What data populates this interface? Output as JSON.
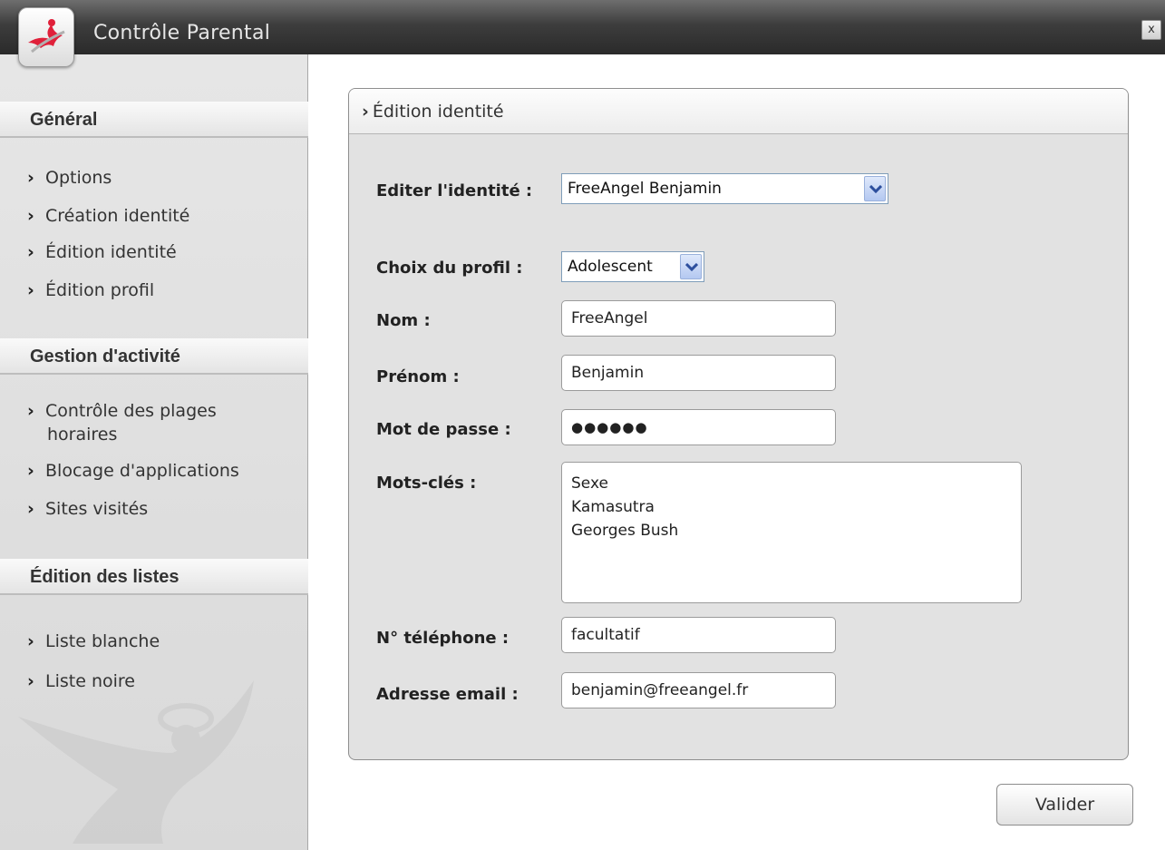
{
  "window": {
    "title": "Contrôle Parental",
    "close_label": "x"
  },
  "sidebar": {
    "sections": [
      {
        "title": "Général",
        "items": [
          "Options",
          "Création identité",
          "Édition identité",
          "Édition profil"
        ]
      },
      {
        "title": "Gestion d'activité",
        "items": [
          "Contrôle des plages",
          "horaires",
          "Blocage d'applications",
          "Sites visités"
        ]
      },
      {
        "title": "Édition des listes",
        "items": [
          "Liste blanche",
          "Liste noire"
        ]
      }
    ]
  },
  "panel": {
    "title": "Édition identité"
  },
  "form": {
    "identity": {
      "label": "Editer l'identité :",
      "value": "FreeAngel Benjamin"
    },
    "profile": {
      "label": "Choix du profil :",
      "value": "Adolescent"
    },
    "nom": {
      "label": "Nom :",
      "value": "FreeAngel"
    },
    "prenom": {
      "label": "Prénom :",
      "value": "Benjamin"
    },
    "password": {
      "label": "Mot de passe :",
      "value": "●●●●●●"
    },
    "keywords": {
      "label": "Mots-clés :",
      "lines": [
        "Sexe",
        "Kamasutra",
        "Georges Bush"
      ]
    },
    "phone": {
      "label": "N° téléphone :",
      "value": "facultatif"
    },
    "email": {
      "label": "Adresse email :",
      "value": "benjamin@freeangel.fr"
    }
  },
  "buttons": {
    "submit": "Valider"
  },
  "icons": {
    "logo": "angel-logo-icon",
    "chevron": "chevron-right-icon",
    "dropdown": "chevron-down-icon"
  },
  "colors": {
    "titlebar": "#3d3d3d",
    "sidebar": "#e2e2e2",
    "accent_red": "#e0203a",
    "select_border": "#7f9db9"
  }
}
